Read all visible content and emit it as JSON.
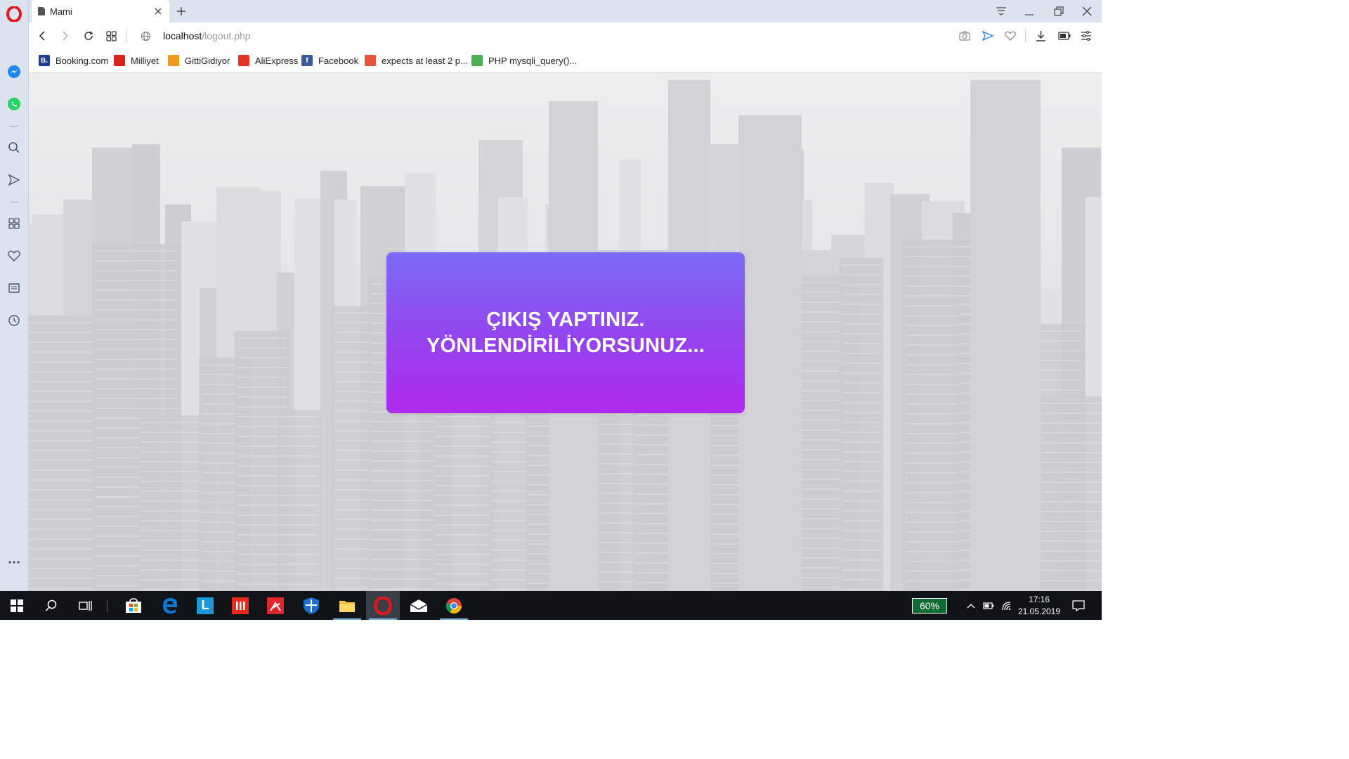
{
  "browser": {
    "tab_title": "Mami",
    "url_host": "localhost",
    "url_path": "/logout.php"
  },
  "bookmarks": [
    {
      "label": "Booking.com",
      "icon": "booking-icon",
      "color": "#1c3f94",
      "glyph": "B."
    },
    {
      "label": "Milliyet",
      "icon": "milliyet-icon",
      "color": "#d9241d",
      "glyph": ""
    },
    {
      "label": "GittiGidiyor",
      "icon": "gittigidiyor-icon",
      "color": "#f29a1c",
      "glyph": ""
    },
    {
      "label": "AliExpress",
      "icon": "aliexpress-icon",
      "color": "#e43225",
      "glyph": ""
    },
    {
      "label": "Facebook",
      "icon": "facebook-icon",
      "color": "#3b5998",
      "glyph": "f"
    },
    {
      "label": "expects at least 2 p...",
      "icon": "php-icon",
      "color": "#e8533d",
      "glyph": ""
    },
    {
      "label": "PHP mysqli_query()...",
      "icon": "w3schools-icon",
      "color": "#4caf50",
      "glyph": ""
    }
  ],
  "page": {
    "message_line1": "ÇIKIŞ YAPTINIZ.",
    "message_line2": "YÖNLENDİRİLİYORSUNUZ...",
    "card_gradient": [
      "#7b6cf6",
      "#b02aee"
    ]
  },
  "taskbar": {
    "battery_percent": "60%",
    "time": "17:16",
    "date": "21.05.2019"
  }
}
